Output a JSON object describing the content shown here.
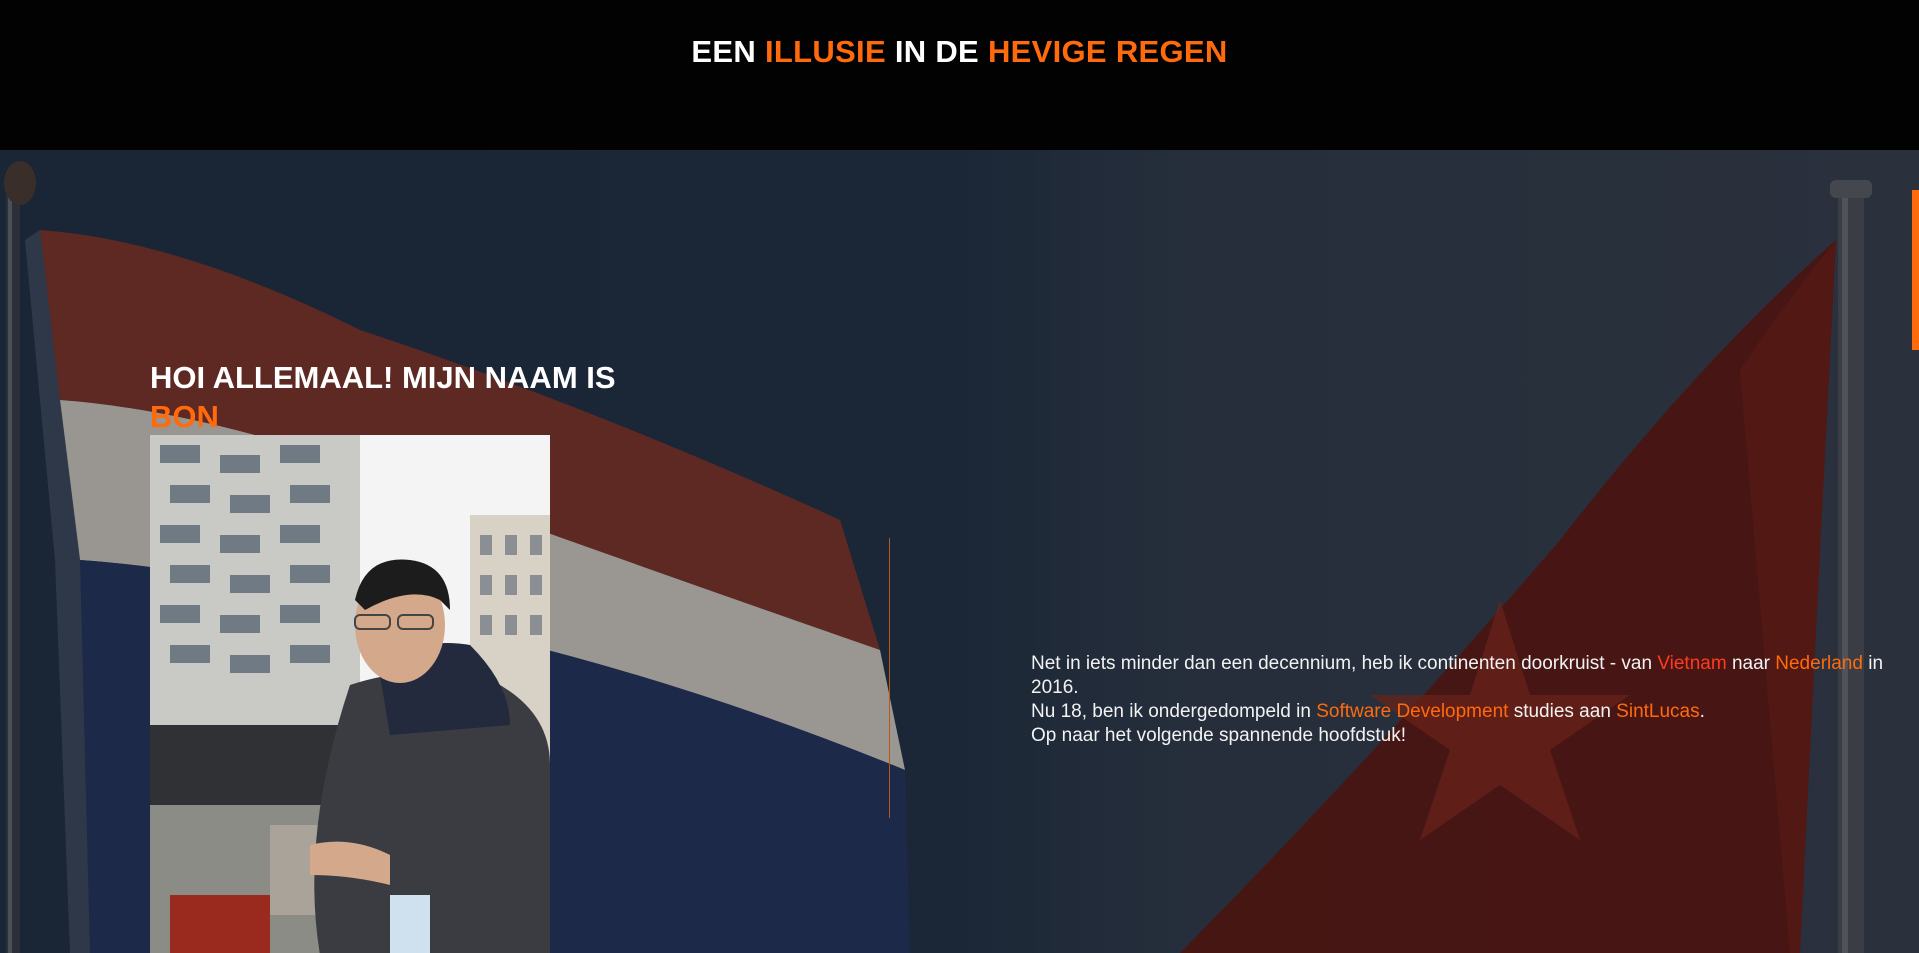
{
  "header": {
    "title_parts": [
      "EEN",
      "ILLUSIE",
      "IN DE",
      "HEVIGE REGEN"
    ]
  },
  "intro": {
    "greeting": "HOI ALLEMAAL! MIJN NAAM IS",
    "name": "BON"
  },
  "bio": {
    "line1_a": "Net in iets minder dan een decennium, heb ik continenten doorkruist - van ",
    "vietnam": "Vietnam",
    "line1_b": " naar ",
    "nederland": "Nederland",
    "line1_c": " in 2016.",
    "line2_a": "Nu 18, ben ik ondergedompeld in ",
    "software": "Software Development",
    "line2_b": " studies aan ",
    "school": "SintLucas",
    "line2_c": ".",
    "line3": "Op naar het volgende spannende hoofdstuk!"
  },
  "colors": {
    "accent": "#ff6a0d",
    "link_red": "#ff3b1f",
    "header_bg": "#020202",
    "hero_bg": "#1b2737"
  }
}
